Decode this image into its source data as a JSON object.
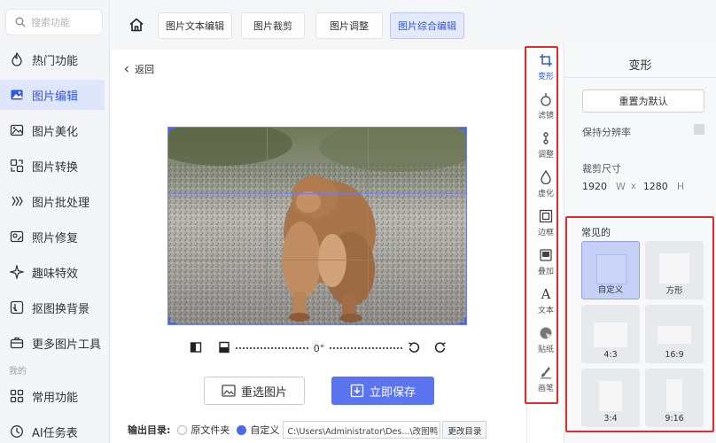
{
  "search": {
    "placeholder": "搜索功能"
  },
  "sidebar": {
    "items": [
      {
        "label": "热门功能",
        "icon": "flame-icon"
      },
      {
        "label": "图片编辑",
        "icon": "image-edit-icon"
      },
      {
        "label": "图片美化",
        "icon": "image-beautify-icon"
      },
      {
        "label": "图片转换",
        "icon": "image-convert-icon"
      },
      {
        "label": "图片批处理",
        "icon": "batch-icon"
      },
      {
        "label": "照片修复",
        "icon": "photo-repair-icon"
      },
      {
        "label": "趣味特效",
        "icon": "sparkle-icon"
      },
      {
        "label": "抠图换背景",
        "icon": "cutout-icon"
      },
      {
        "label": "更多图片工具",
        "icon": "toolbox-icon"
      },
      {
        "label": "常用功能",
        "icon": "grid-icon"
      },
      {
        "label": "AI任务表",
        "icon": "clock-icon"
      }
    ],
    "section_mine": "我的"
  },
  "tabs": [
    "图片文本编辑",
    "图片裁剪",
    "图片调整",
    "图片综合编辑"
  ],
  "back_label": "返回",
  "controls": {
    "rotation": "0°"
  },
  "buttons": {
    "reselect": "重选图片",
    "save": "立即保存"
  },
  "output": {
    "label": "输出目录:",
    "opt_original": "原文件夹",
    "opt_custom": "自定义",
    "path": "C:\\Users\\Administrator\\Des...\\改图鸭",
    "change": "更改目录"
  },
  "tools": [
    {
      "label": "变形",
      "icon": "crop-icon"
    },
    {
      "label": "滤镜",
      "icon": "filter-icon"
    },
    {
      "label": "调整",
      "icon": "adjust-icon"
    },
    {
      "label": "虚化",
      "icon": "blur-icon"
    },
    {
      "label": "边框",
      "icon": "frame-icon"
    },
    {
      "label": "叠加",
      "icon": "overlay-icon"
    },
    {
      "label": "文本",
      "icon": "text-icon"
    },
    {
      "label": "贴纸",
      "icon": "sticker-icon"
    },
    {
      "label": "画笔",
      "icon": "brush-icon"
    }
  ],
  "panel": {
    "title": "变形",
    "reset": "重置为默认",
    "keep_resolution": "保持分辨率",
    "crop_size": "裁剪尺寸",
    "width": "1920",
    "width_unit": "W",
    "times": "x",
    "height": "1280",
    "height_unit": "H",
    "common": "常见的",
    "presets": [
      "自定义",
      "方形",
      "4:3",
      "16:9",
      "3:4",
      "9:16"
    ]
  },
  "colors": {
    "accent": "#2f57e4",
    "save": "#5b74ef",
    "highlight": "#e02b2b"
  }
}
